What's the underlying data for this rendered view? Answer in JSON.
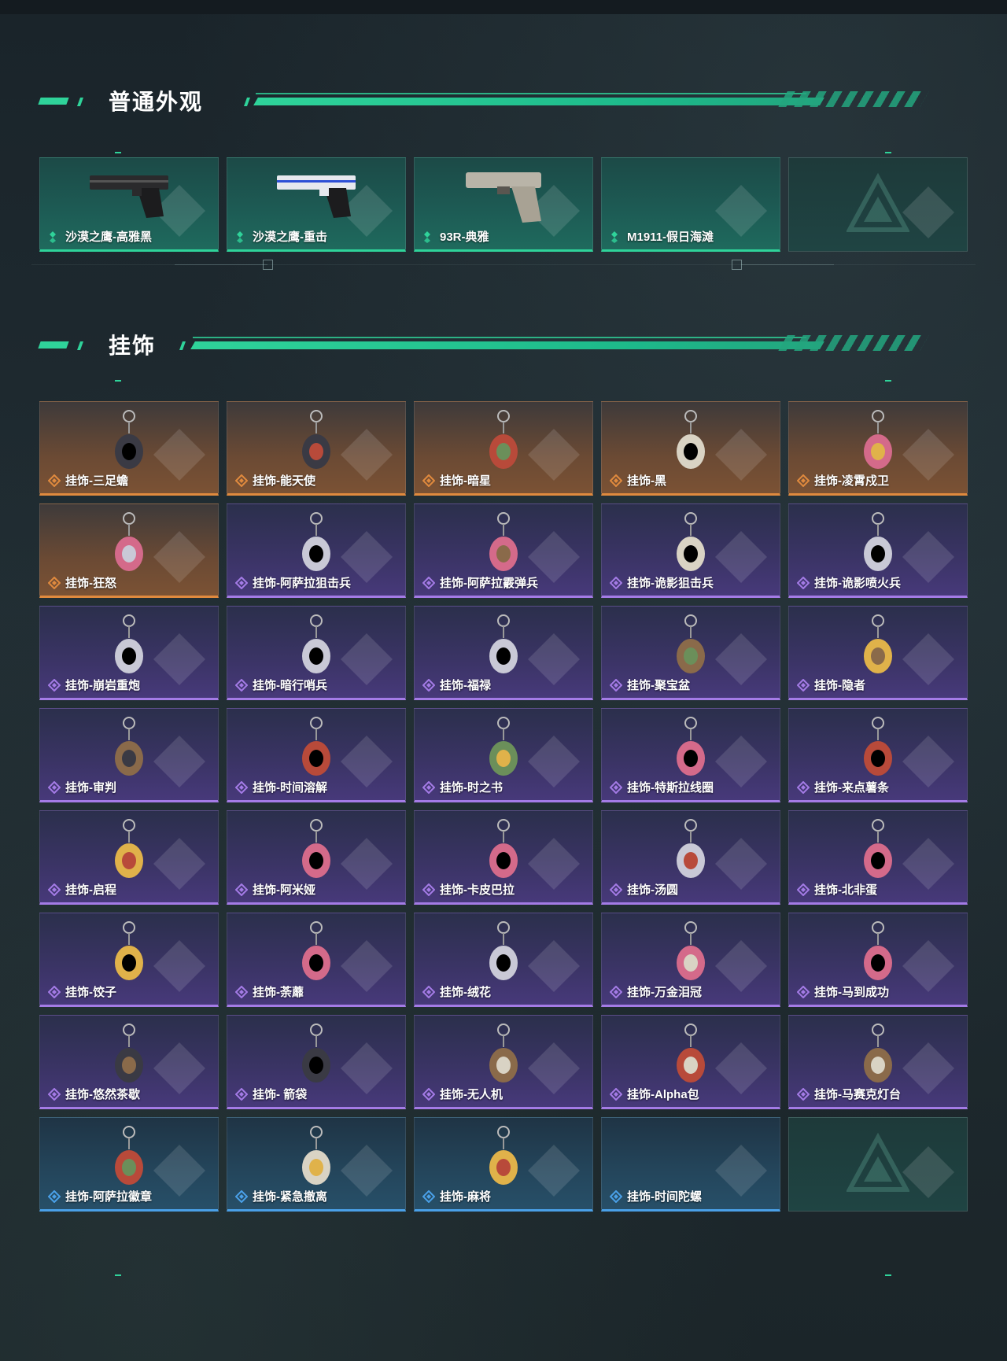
{
  "sections": {
    "skins": {
      "title": "普通外观"
    },
    "charms": {
      "title": "挂饰"
    }
  },
  "colors": {
    "accent": "#2fd39a",
    "legendary": "#e08a3e",
    "epic": "#a47be6",
    "rare": "#4aa0e8",
    "green_tier": "#2fd39a"
  },
  "skins": [
    {
      "label": "沙漠之鹰-高雅黑",
      "rarity": "green",
      "icon": "deagle-black-icon"
    },
    {
      "label": "沙漠之鹰-重击",
      "rarity": "green",
      "icon": "deagle-white-icon"
    },
    {
      "label": "93R-典雅",
      "rarity": "green",
      "icon": "pistol-93r-icon"
    },
    {
      "label": "M1911-假日海滩",
      "rarity": "green",
      "icon": ""
    },
    {
      "label": "",
      "rarity": "empty",
      "icon": "logo-icon"
    }
  ],
  "charms": [
    {
      "label": "挂饰-三足蟾",
      "rarity": "orange",
      "icon": "toad-charm-icon"
    },
    {
      "label": "挂饰-能天使",
      "rarity": "orange",
      "icon": "angel-tag-charm-icon"
    },
    {
      "label": "挂饰-暗星",
      "rarity": "orange",
      "icon": "feather-charm-icon"
    },
    {
      "label": "挂饰-黑",
      "rarity": "orange",
      "icon": "black-tag-charm-icon"
    },
    {
      "label": "挂饰-凌霄戍卫",
      "rarity": "orange",
      "icon": "guard-charm-icon"
    },
    {
      "label": "挂饰-狂怒",
      "rarity": "orange",
      "icon": "rage-charm-icon"
    },
    {
      "label": "挂饰-阿萨拉狙击兵",
      "rarity": "purple",
      "icon": "sniper-charm-icon"
    },
    {
      "label": "挂饰-阿萨拉霰弹兵",
      "rarity": "purple",
      "icon": "shotgunner-charm-icon"
    },
    {
      "label": "挂饰-诡影狙击兵",
      "rarity": "purple",
      "icon": "shadow-sniper-charm-icon"
    },
    {
      "label": "挂饰-诡影喷火兵",
      "rarity": "purple",
      "icon": "flamer-charm-icon"
    },
    {
      "label": "挂饰-崩岩重炮",
      "rarity": "purple",
      "icon": "heavy-charm-icon"
    },
    {
      "label": "挂饰-暗行哨兵",
      "rarity": "purple",
      "icon": "sentry-charm-icon"
    },
    {
      "label": "挂饰-福禄",
      "rarity": "purple",
      "icon": "gourd-charm-icon"
    },
    {
      "label": "挂饰-聚宝盆",
      "rarity": "purple",
      "icon": "treasure-bowl-charm-icon"
    },
    {
      "label": "挂饰-隐者",
      "rarity": "purple",
      "icon": "hermit-card-charm-icon"
    },
    {
      "label": "挂饰-审判",
      "rarity": "purple",
      "icon": "judgement-card-charm-icon"
    },
    {
      "label": "挂饰-时间溶解",
      "rarity": "purple",
      "icon": "melting-clock-charm-icon"
    },
    {
      "label": "挂饰-时之书",
      "rarity": "purple",
      "icon": "book-charm-icon"
    },
    {
      "label": "挂饰-特斯拉线圈",
      "rarity": "purple",
      "icon": "tesla-coil-charm-icon"
    },
    {
      "label": "挂饰-来点薯条",
      "rarity": "purple",
      "icon": "fries-charm-icon"
    },
    {
      "label": "挂饰-启程",
      "rarity": "purple",
      "icon": "compass-charm-icon"
    },
    {
      "label": "挂饰-阿米娅",
      "rarity": "purple",
      "icon": "amiya-charm-icon"
    },
    {
      "label": "挂饰-卡皮巴拉",
      "rarity": "purple",
      "icon": "capybara-charm-icon"
    },
    {
      "label": "挂饰-汤圆",
      "rarity": "purple",
      "icon": "tangyuan-charm-icon"
    },
    {
      "label": "挂饰-北非蛋",
      "rarity": "purple",
      "icon": "egg-charm-icon"
    },
    {
      "label": "挂饰-饺子",
      "rarity": "purple",
      "icon": "dumpling-charm-icon"
    },
    {
      "label": "挂饰-荼蘼",
      "rarity": "purple",
      "icon": "flower-doll-charm-icon"
    },
    {
      "label": "挂饰-绒花",
      "rarity": "purple",
      "icon": "rose-charm-icon"
    },
    {
      "label": "挂饰-万金泪冠",
      "rarity": "purple",
      "icon": "burger-charm-icon"
    },
    {
      "label": "挂饰-马到成功",
      "rarity": "purple",
      "icon": "horse-charm-icon"
    },
    {
      "label": "挂饰-悠然茶歇",
      "rarity": "purple",
      "icon": "cupcake-charm-icon"
    },
    {
      "label": "挂饰- 箭袋",
      "rarity": "purple",
      "icon": "quiver-charm-icon"
    },
    {
      "label": "挂饰-无人机",
      "rarity": "purple",
      "icon": "drone-charm-icon"
    },
    {
      "label": "挂饰-Alpha包",
      "rarity": "purple",
      "icon": "pouch-charm-icon"
    },
    {
      "label": "挂饰-马赛克灯台",
      "rarity": "purple",
      "icon": "lamp-charm-icon"
    },
    {
      "label": "挂饰-阿萨拉徽章",
      "rarity": "blue",
      "icon": "badge-charm-icon"
    },
    {
      "label": "挂饰-紧急撤离",
      "rarity": "blue",
      "icon": "exit-sign-charm-icon"
    },
    {
      "label": "挂饰-麻将",
      "rarity": "blue",
      "icon": "mahjong-charm-icon"
    },
    {
      "label": "挂饰-时间陀螺",
      "rarity": "blue",
      "icon": ""
    },
    {
      "label": "",
      "rarity": "empty",
      "icon": "logo-icon"
    }
  ]
}
